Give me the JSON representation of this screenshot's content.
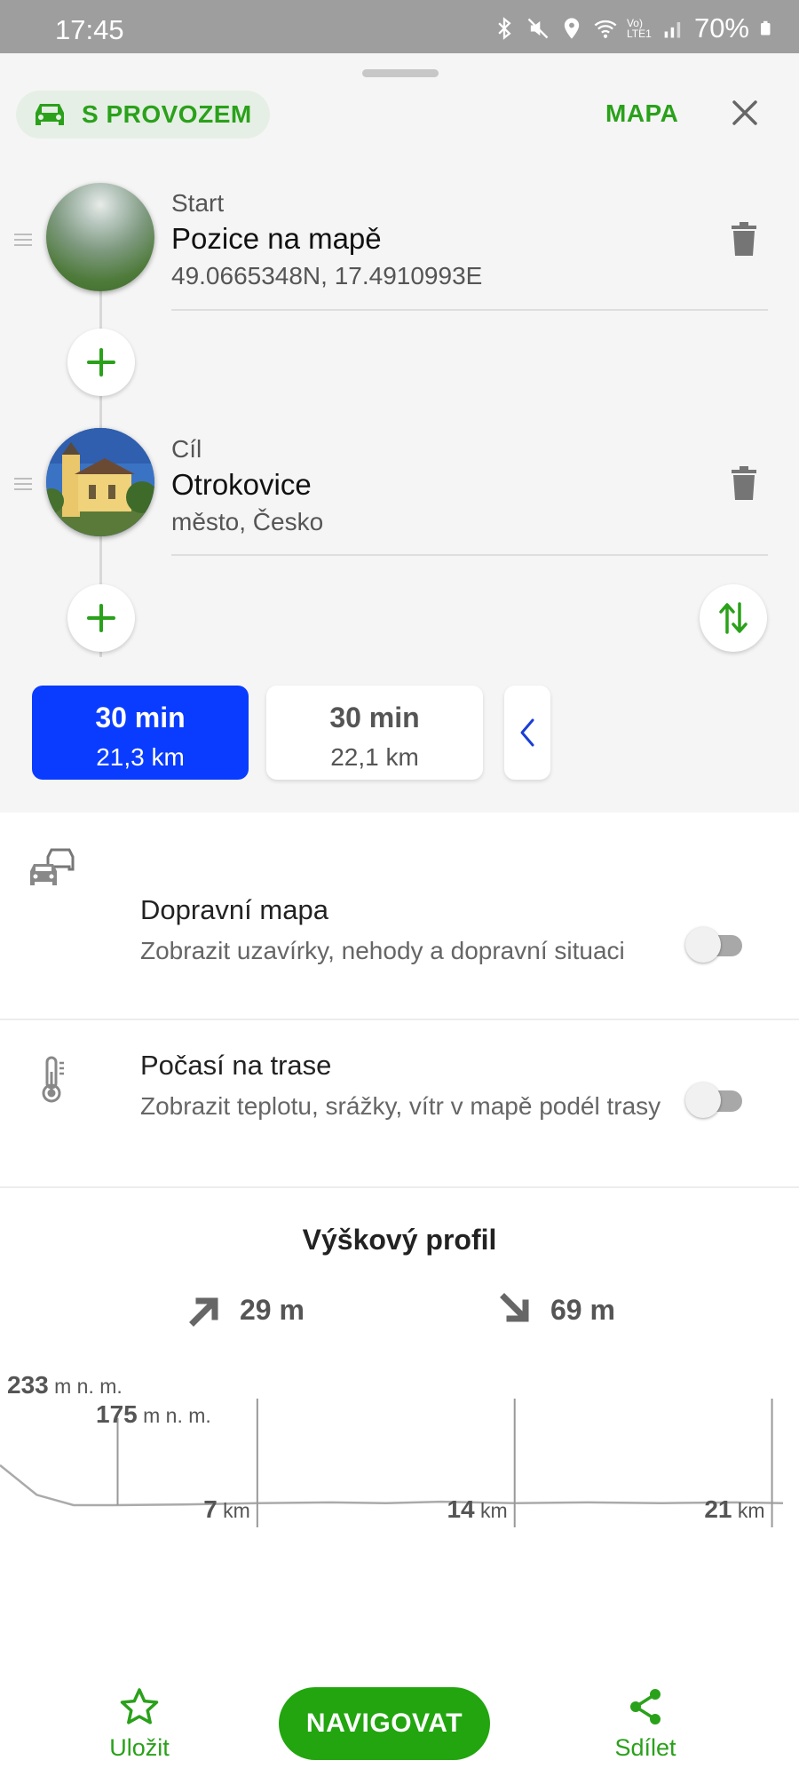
{
  "status_bar": {
    "time": "17:45",
    "battery": "70%",
    "network_label": "Vo) LTE1"
  },
  "header": {
    "traffic_chip": "S PROVOZEM",
    "map_label": "MAPA"
  },
  "waypoints": [
    {
      "kind": "Start",
      "name": "Pozice na mapě",
      "detail": "49.0665348N, 17.4910993E"
    },
    {
      "kind": "Cíl",
      "name": "Otrokovice",
      "detail": "město, Česko"
    }
  ],
  "routes": [
    {
      "time": "30 min",
      "distance": "21,3 km",
      "selected": true
    },
    {
      "time": "30 min",
      "distance": "22,1 km",
      "selected": false
    }
  ],
  "settings": [
    {
      "title": "Dopravní mapa",
      "subtitle": "Zobrazit uzavírky, nehody a dopravní situaci",
      "enabled": false,
      "icon": "traffic-cars-icon"
    },
    {
      "title": "Počasí na trase",
      "subtitle": "Zobrazit teplotu, srážky, vítr v mapě podél trasy",
      "enabled": false,
      "icon": "thermometer-icon"
    }
  ],
  "elevation": {
    "title": "Výškový profil",
    "ascent": "29 m",
    "descent": "69 m",
    "max_value": "233",
    "min_value": "175",
    "unit_label": "m n. m."
  },
  "chart_data": {
    "type": "area",
    "title": "Výškový profil",
    "x": [
      0,
      1,
      2,
      3,
      5,
      7,
      9,
      10.5,
      12,
      14,
      16,
      18,
      20,
      21.3
    ],
    "y": [
      233,
      190,
      175,
      175,
      176,
      178,
      179,
      178,
      180,
      178,
      179,
      178,
      179,
      178
    ],
    "xticks": [
      "7",
      "14",
      "21"
    ],
    "xunit": "km",
    "ylabels": [
      {
        "value": "233",
        "unit": "m n. m."
      },
      {
        "value": "175",
        "unit": "m n. m."
      }
    ],
    "grid": false
  },
  "bottom_bar": {
    "save_label": "Uložit",
    "navigate_label": "NAVIGOVAT",
    "share_label": "Sdílet"
  },
  "colors": {
    "accent_green": "#2aa11a",
    "selected_route_blue": "#0a3cff",
    "navigate_green": "#22a50f"
  }
}
